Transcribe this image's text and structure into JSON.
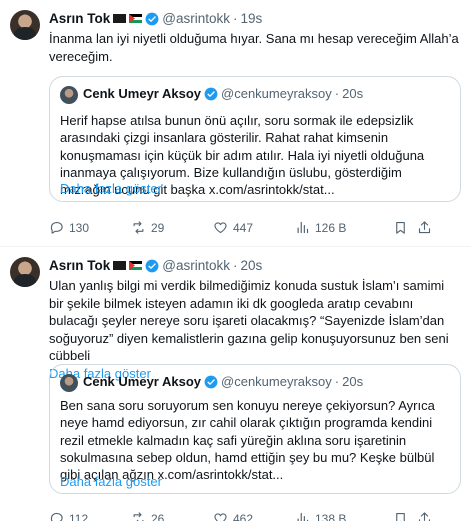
{
  "tweets": [
    {
      "author_name": "Asrın Tok",
      "handle": "@asrintokk",
      "dot": "·",
      "time": "19s",
      "text": "İnanma lan iyi niyetli olduğuma hıyar. Sana mı hesap vereceğim Allah’a vereceğim.",
      "show_more": "",
      "quote": {
        "author_name": "Cenk Umeyr Aksoy",
        "handle": "@cenkumeyraksoy",
        "dot": "·",
        "time": "20s",
        "text": "Herif hapse atılsa bunun önü açılır, soru sormak ile edepsizlik arasındaki çizgi insanlara gösterilir. Rahat rahat kimsenin konuşmaması için küçük bir adım atılır. Hala iyi niyetli olduğuna inanmaya çalışıyorum. Bize kullandığın üslubu, gösterdiğim mızrağın ucunu git başka x.com/asrintokk/stat...",
        "show_more": "Daha fazla göster"
      },
      "stats": {
        "replies": "130",
        "reposts": "29",
        "likes": "447",
        "views": "126 B"
      }
    },
    {
      "author_name": "Asrın Tok",
      "handle": "@asrintokk",
      "dot": "·",
      "time": "20s",
      "text": "Ulan yanlış bilgi mi verdik bilmediğimiz konuda sustuk İslam’ı samimi bir şekile bilmek isteyen adamın iki dk googleda aratıp cevabını bulacağı şeyler nereye soru işareti olacakmış? “Sayenizde İslam’dan soğuyoruz” diyen kemalistlerin gazına gelip konuşuyorsunuz ben seni cübbeli",
      "show_more": "Daha fazla göster",
      "quote": {
        "author_name": "Cenk Umeyr Aksoy",
        "handle": "@cenkumeyraksoy",
        "dot": "·",
        "time": "20s",
        "text": "Ben sana soru soruyorum sen konuyu nereye çekiyorsun? Ayrıca neye hamd ediyorsun, zır cahil olarak çıktığın programda kendini rezil etmekle kalmadın kaç safi yüreğin aklına soru işaretinin sokulmasına sebep oldun, hamd ettiğin şey bu mu? Keşke bülbül gibi açılan ağzın x.com/asrintokk/stat...",
        "show_more": "Daha fazla göster"
      },
      "stats": {
        "replies": "112",
        "reposts": "26",
        "likes": "462",
        "views": "138 B"
      }
    }
  ],
  "colors": {
    "link": "#1d9bf0",
    "muted": "#536471",
    "verified": "#1d9bf0",
    "border": "#cfd9de"
  },
  "icons": {
    "reply": "comment-icon",
    "repost": "repost-icon",
    "like": "heart-icon",
    "views": "views-chart-icon",
    "bookmark": "bookmark-icon",
    "share": "share-icon",
    "verified": "verified-badge-icon"
  }
}
